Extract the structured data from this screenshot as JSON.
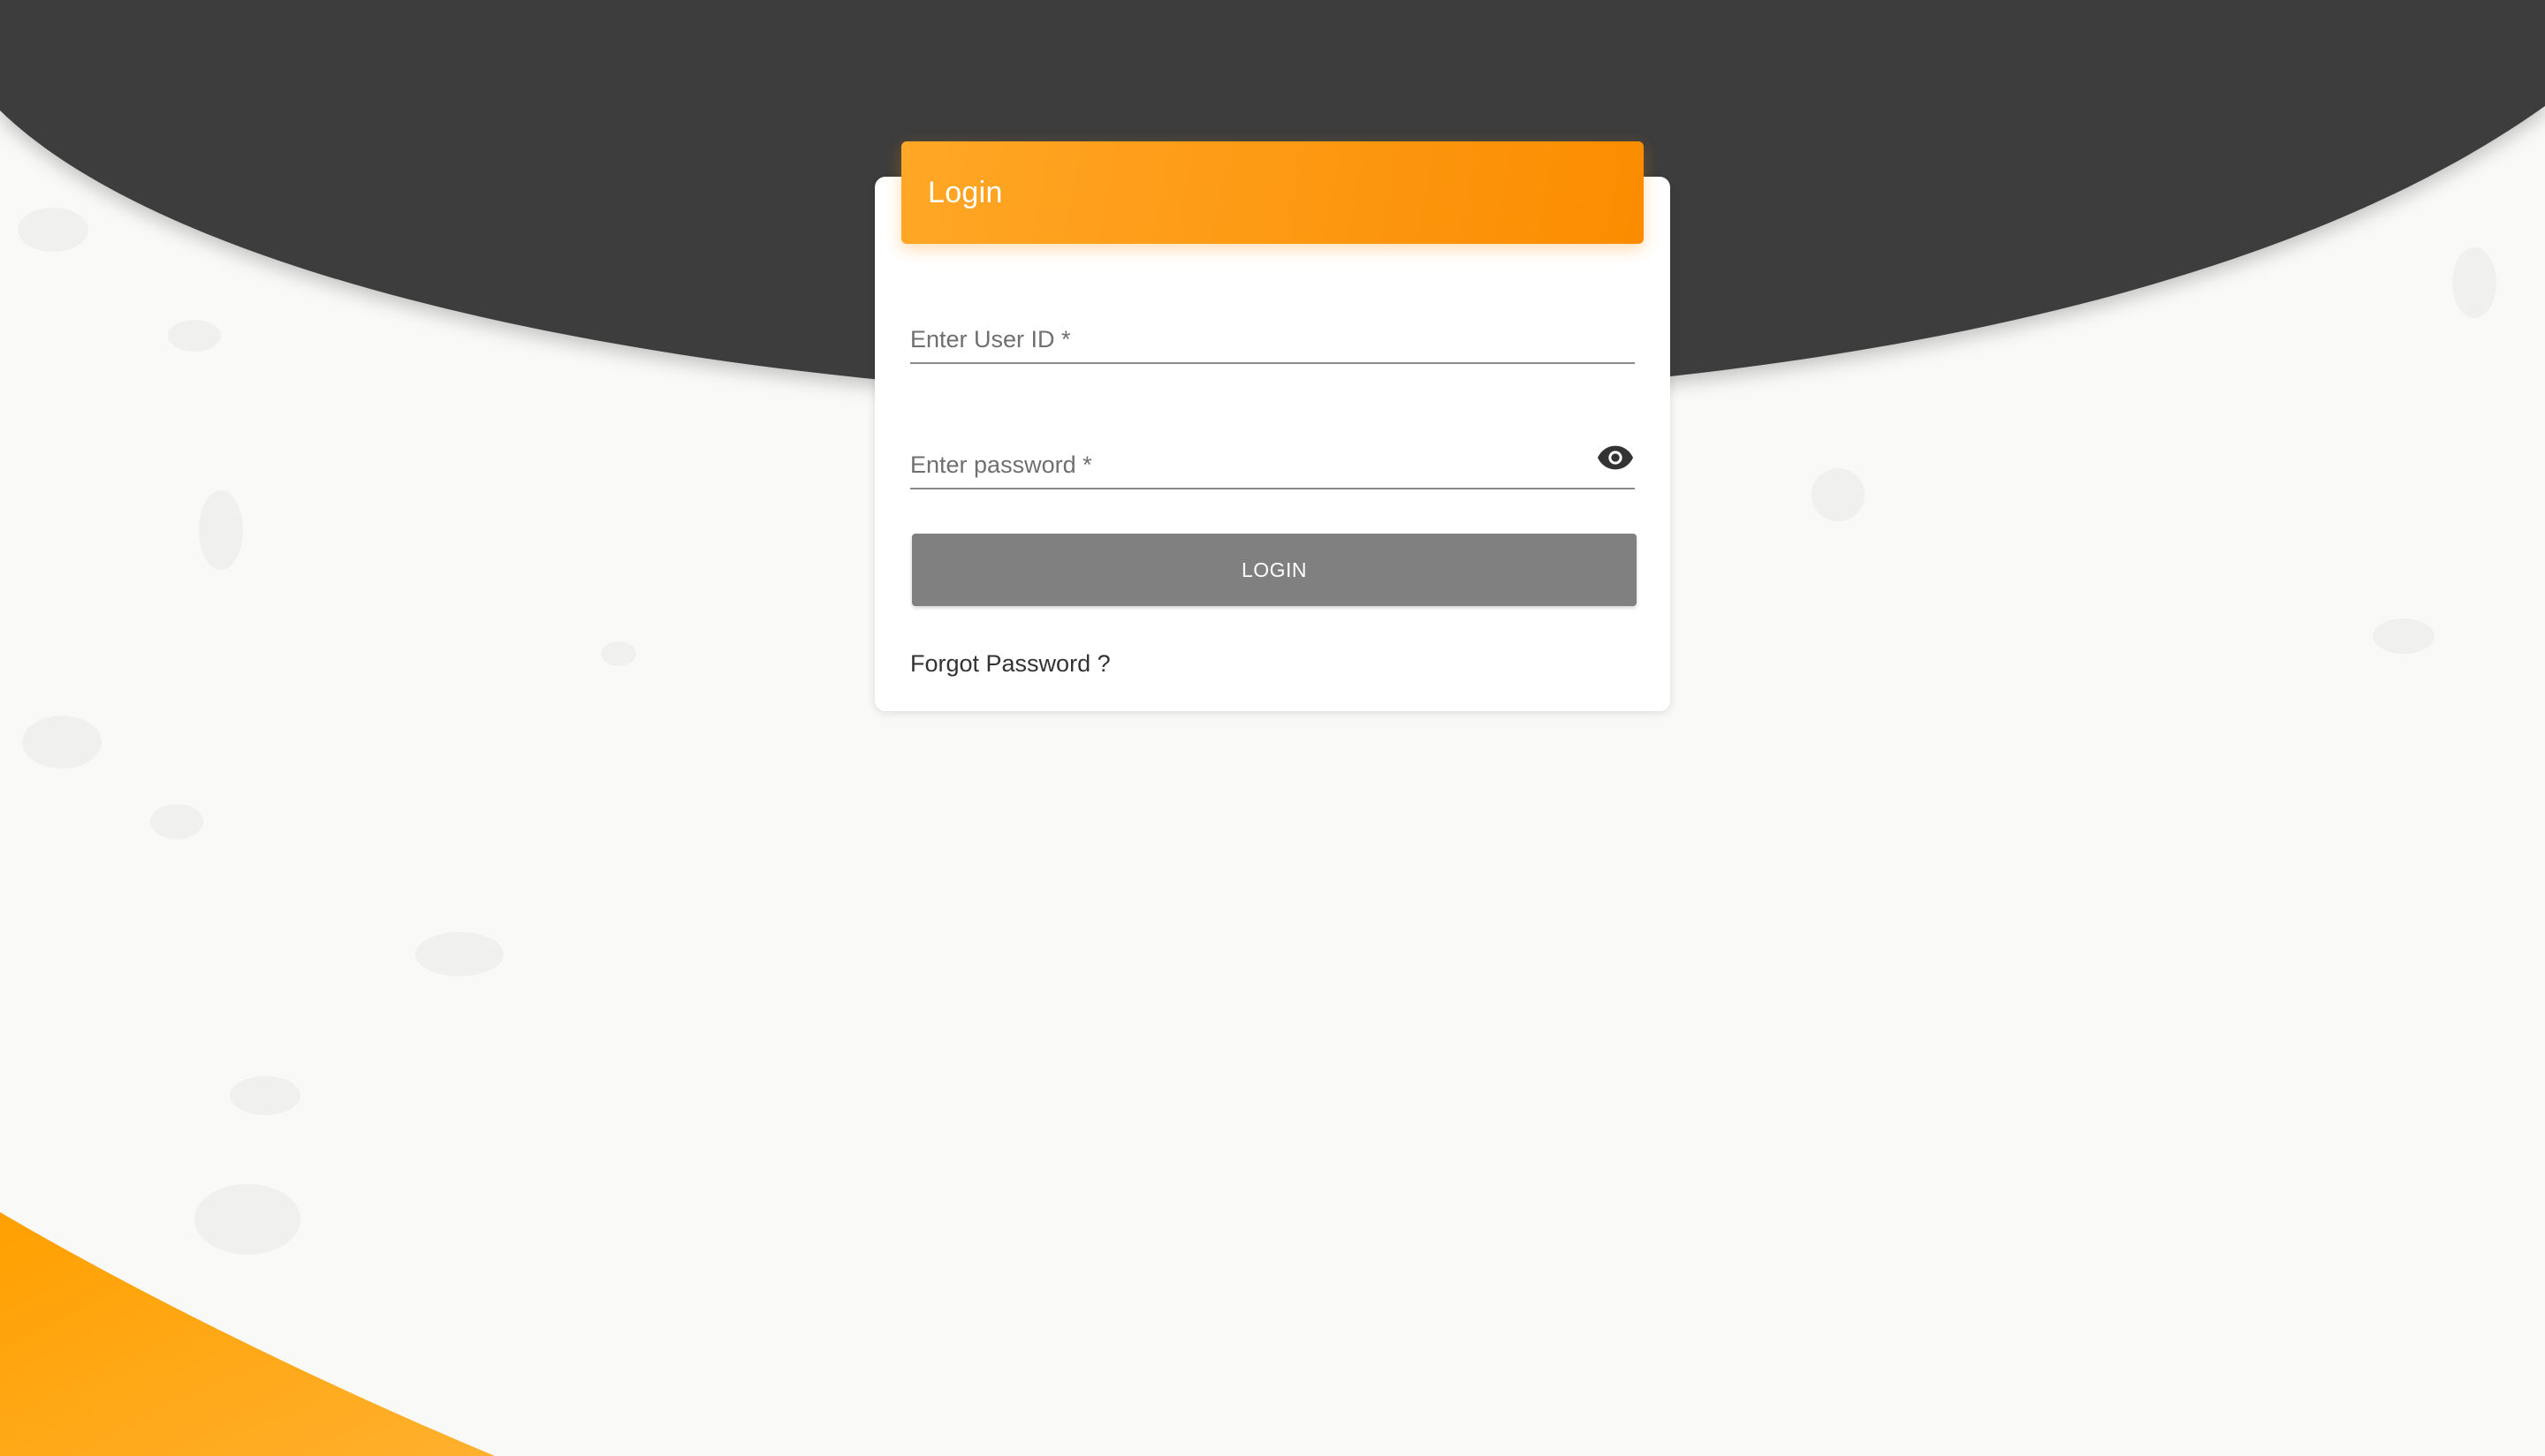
{
  "theme": {
    "dark_bg": "#3c3d3c",
    "accent_orange": "#fb8c00",
    "accent_orange_light": "#ffa726",
    "page_bg": "#f9f9f8",
    "button_bg": "#808080"
  },
  "login_card": {
    "title": "Login",
    "userid_label": "Enter User ID *",
    "password_label": "Enter password *",
    "password_toggle_icon": "eye-icon",
    "submit_label": "LOGIN",
    "forgot_link": "Forgot Password ?"
  }
}
